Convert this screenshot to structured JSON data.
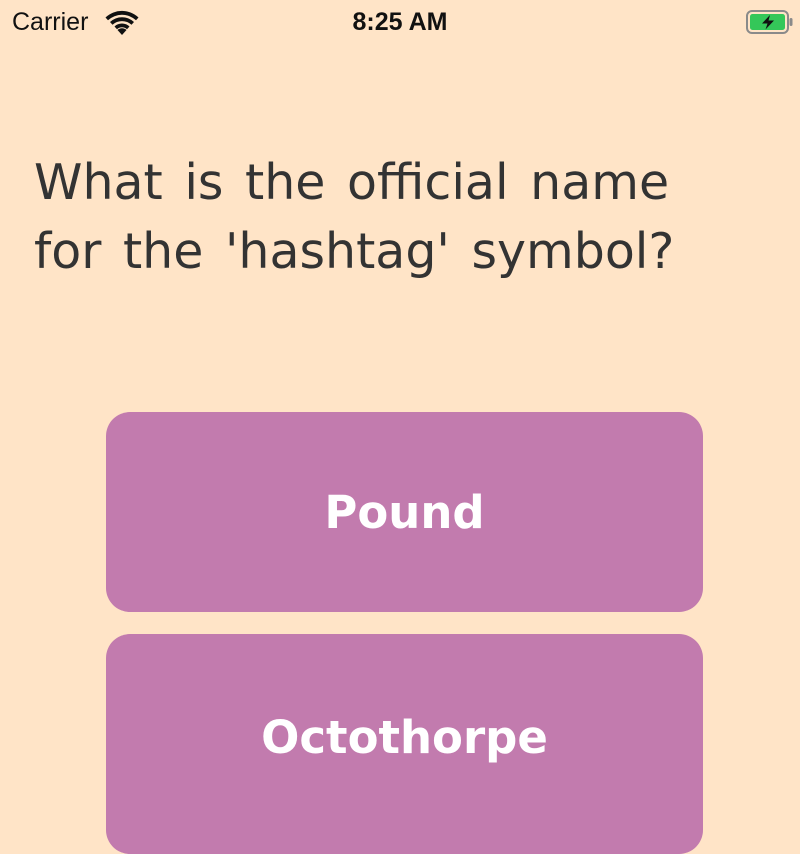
{
  "status_bar": {
    "carrier": "Carrier",
    "time": "8:25 AM",
    "wifi_icon": "wifi-icon",
    "battery_icon": "battery-charging-icon",
    "battery_color": "#34C759"
  },
  "quiz": {
    "question": "What is the official name for the 'hashtag' symbol?",
    "answers": [
      {
        "label": "Pound"
      },
      {
        "label": "Octothorpe"
      }
    ]
  },
  "colors": {
    "background": "#FFE4C7",
    "button": "#C27BAE",
    "button_text": "#FFFFFF",
    "question_text": "#333333"
  }
}
